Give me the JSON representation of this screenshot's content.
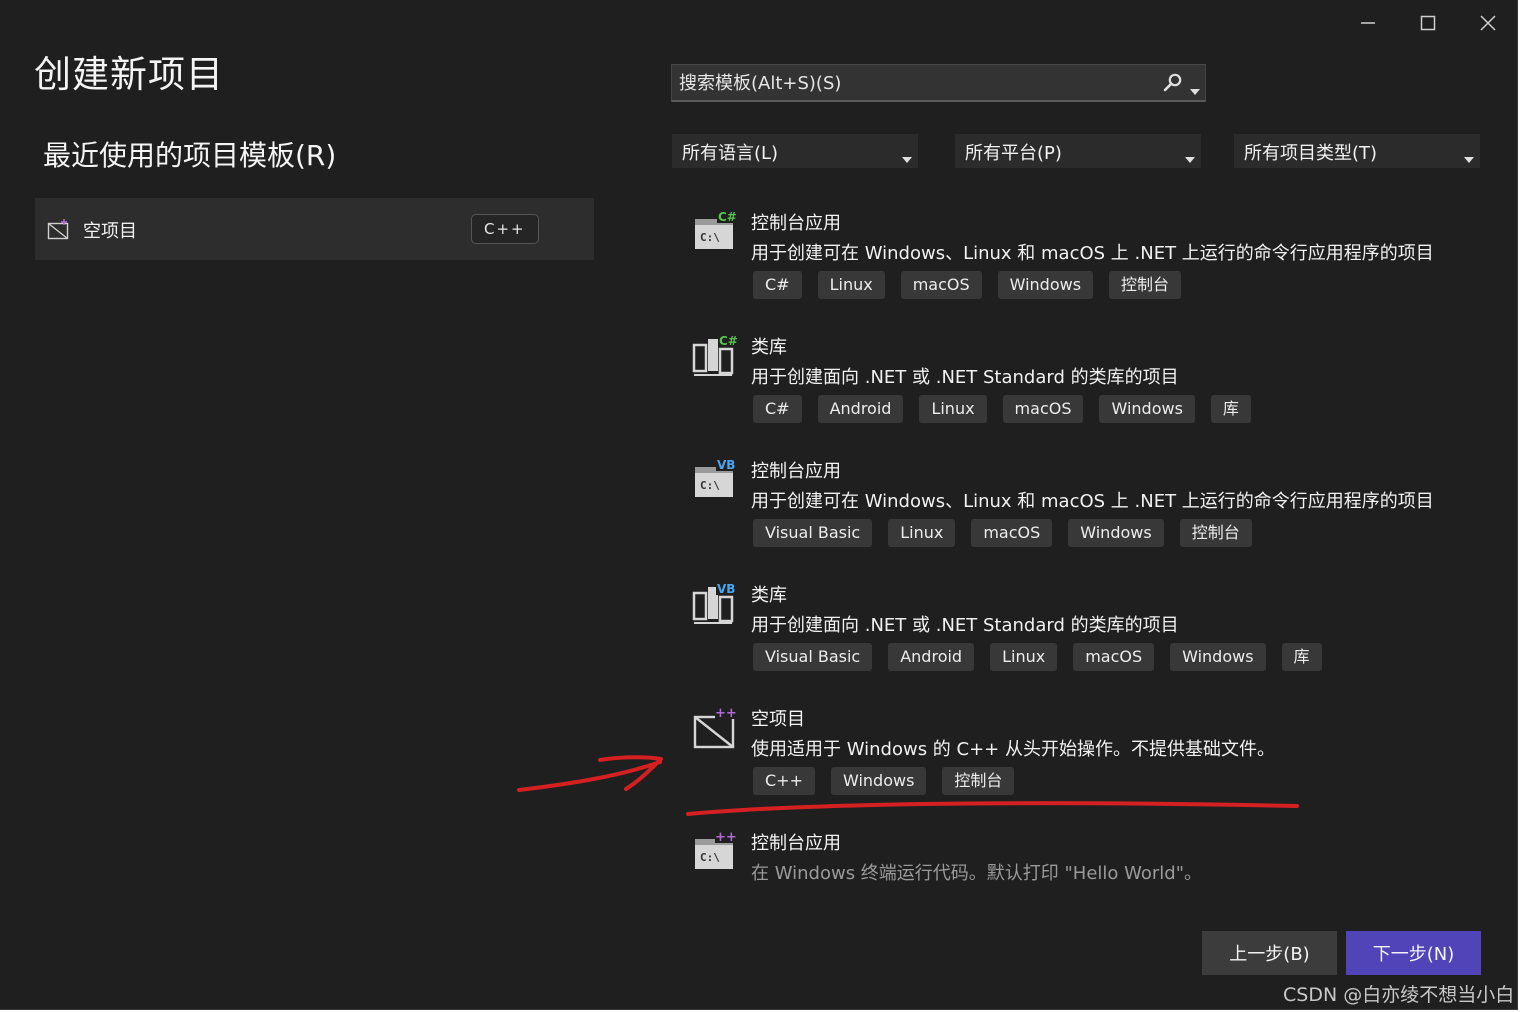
{
  "window": {
    "title": "创建新项目",
    "controls": [
      "minimize-icon",
      "maximize-icon",
      "close-icon"
    ]
  },
  "recent": {
    "heading": "最近使用的项目模板(R)",
    "items": [
      {
        "label": "空项目",
        "tag": "C++",
        "icon": "empty-project-icon"
      }
    ]
  },
  "search": {
    "placeholder": "搜索模板(Alt+S)(S)",
    "icon": "search-icon"
  },
  "filters": {
    "language": "所有语言(L)",
    "platform": "所有平台(P)",
    "project_type": "所有项目类型(T)"
  },
  "templates": [
    {
      "name": "控制台应用",
      "desc": "用于创建可在 Windows、Linux 和 macOS 上 .NET 上运行的命令行应用程序的项目",
      "icon": "csharp-console-icon",
      "tags": [
        "C#",
        "Linux",
        "macOS",
        "Windows",
        "控制台"
      ]
    },
    {
      "name": "类库",
      "desc": "用于创建面向 .NET 或 .NET Standard 的类库的项目",
      "icon": "csharp-library-icon",
      "tags": [
        "C#",
        "Android",
        "Linux",
        "macOS",
        "Windows",
        "库"
      ]
    },
    {
      "name": "控制台应用",
      "desc": "用于创建可在 Windows、Linux 和 macOS 上 .NET 上运行的命令行应用程序的项目",
      "icon": "vb-console-icon",
      "tags": [
        "Visual Basic",
        "Linux",
        "macOS",
        "Windows",
        "控制台"
      ]
    },
    {
      "name": "类库",
      "desc": "用于创建面向 .NET 或 .NET Standard 的类库的项目",
      "icon": "vb-library-icon",
      "tags": [
        "Visual Basic",
        "Android",
        "Linux",
        "macOS",
        "Windows",
        "库"
      ]
    },
    {
      "name": "空项目",
      "desc": "使用适用于 Windows 的 C++ 从头开始操作。不提供基础文件。",
      "icon": "cpp-empty-project-icon",
      "tags": [
        "C++",
        "Windows",
        "控制台"
      ]
    },
    {
      "name": "控制台应用",
      "desc": "在 Windows 终端运行代码。默认打印 \"Hello World\"。",
      "icon": "cpp-console-icon",
      "tags": []
    }
  ],
  "buttons": {
    "back": "上一步(B)",
    "next": "下一步(N)"
  },
  "watermark": "CSDN @白亦绫不想当小白",
  "colors": {
    "background": "#1f1f1f",
    "accent": "#5144b8",
    "annotation": "#d42020",
    "csharp_badge": "#57c24d",
    "vb_badge": "#4aa4ee",
    "cpp_badge": "#b36ad6"
  }
}
